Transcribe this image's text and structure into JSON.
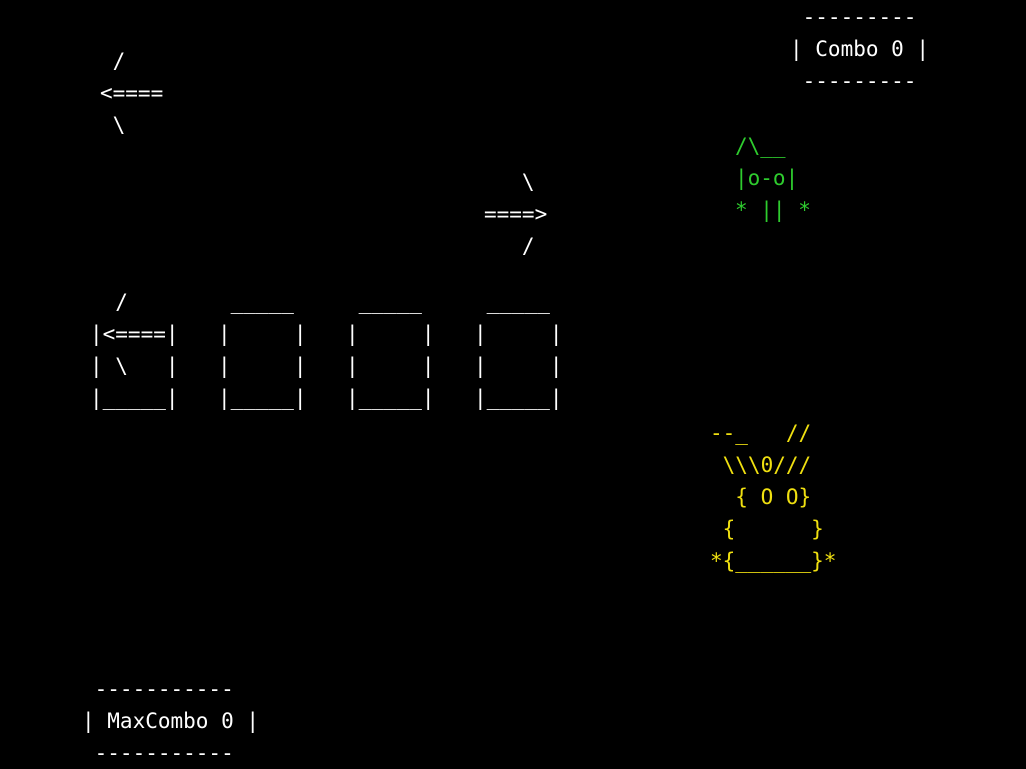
{
  "colors": {
    "background": "#000000",
    "ui_text": "#ffffff",
    "green_creature": "#2ecc2e",
    "yellow_creature": "#f0e010"
  },
  "hud": {
    "combo": {
      "label": "Combo",
      "value": "0",
      "art": " ---------\n| Combo 0 |\n ---------"
    },
    "max_combo": {
      "label": "MaxCombo",
      "value": "0",
      "art": " -----------\n| MaxCombo 0 |\n -----------"
    }
  },
  "incoming_arrows": [
    {
      "direction": "left",
      "art": " /\n<====\n \\"
    },
    {
      "direction": "right",
      "art": "   \\\n====>\n   /"
    }
  ],
  "input_slots": [
    {
      "index": 1,
      "content": "left-arrow",
      "art": "  /\n|<====|\n| \\   |\n|_____|"
    },
    {
      "index": 2,
      "content": "empty",
      "art": " _____\n|     |\n|     |\n|_____|"
    },
    {
      "index": 3,
      "content": "empty",
      "art": " _____\n|     |\n|     |\n|_____|"
    },
    {
      "index": 4,
      "content": "empty",
      "art": " _____\n|     |\n|     |\n|_____|"
    }
  ],
  "creatures": {
    "green": {
      "icon": "green-bug-creature",
      "art": "/\\__\n|o-o|\n* || *"
    },
    "yellow": {
      "icon": "yellow-crowned-creature",
      "art": "--_   //\n \\\\\\0///\n  { O O}\n {      }\n*{______}*"
    }
  }
}
